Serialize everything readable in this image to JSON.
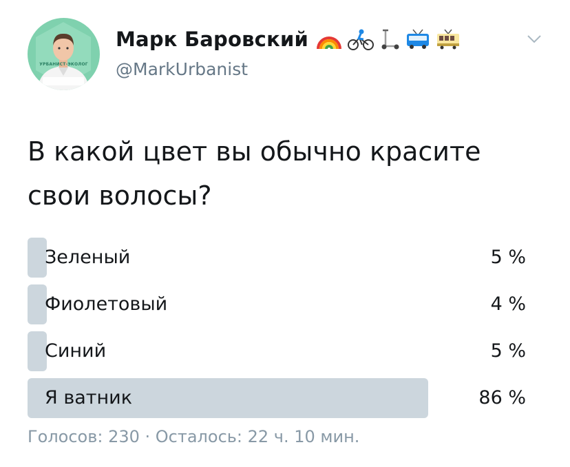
{
  "user": {
    "display_name": "Марк Баровский",
    "handle": "@MarkUrbanist",
    "avatar_badge": "УРБАНИСТ-ЭКОЛОГ",
    "name_emojis": [
      "rainbow-icon",
      "cyclist-icon",
      "scooter-icon",
      "trolleybus-icon",
      "tram-icon"
    ]
  },
  "tweet": {
    "question": "В какой цвет вы обычно красите свои волосы?"
  },
  "poll": {
    "options": [
      {
        "label": "Зеленый",
        "percent_label": "5 %",
        "percent": 5
      },
      {
        "label": "Фиолетовый",
        "percent_label": "4 %",
        "percent": 4
      },
      {
        "label": "Синий",
        "percent_label": "5 %",
        "percent": 5
      },
      {
        "label": "Я ватник",
        "percent_label": "86 %",
        "percent": 86
      }
    ],
    "meta": "Голосов: 230 · Осталось: 22 ч. 10 мин."
  },
  "colors": {
    "bar": "#ccd6dd",
    "muted_text": "#8899a6",
    "handle_text": "#657786",
    "avatar_bg": "#7fd1ae"
  }
}
